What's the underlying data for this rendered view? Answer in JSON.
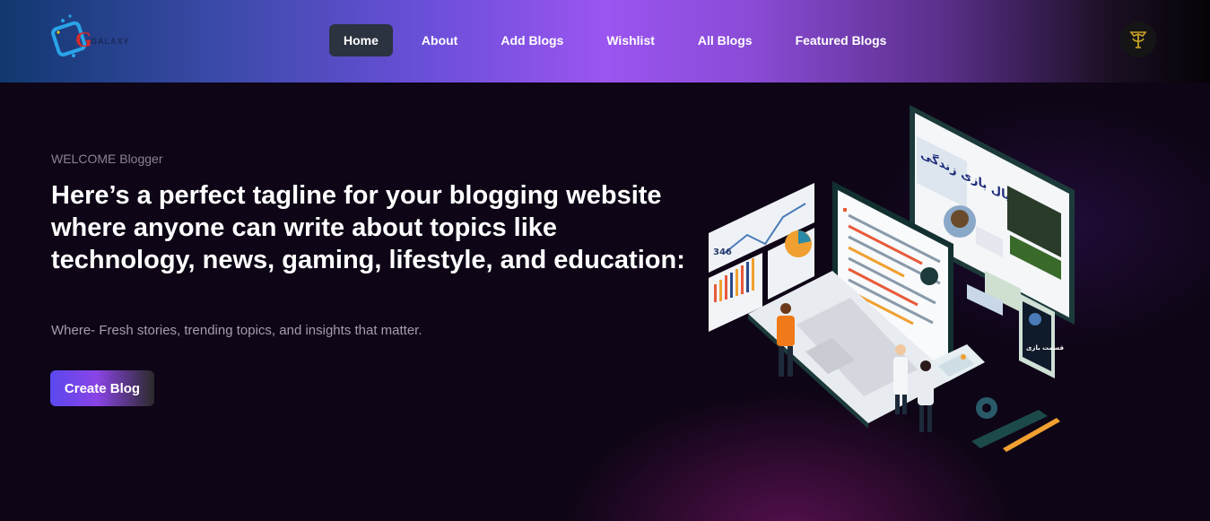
{
  "logo": {
    "text": "GALAXY",
    "icon": "galaxy-logo-icon"
  },
  "nav": {
    "items": [
      {
        "label": "Home",
        "active": true
      },
      {
        "label": "About",
        "active": false
      },
      {
        "label": "Add Blogs",
        "active": false
      },
      {
        "label": "Wishlist",
        "active": false
      },
      {
        "label": "All Blogs",
        "active": false
      },
      {
        "label": "Featured Blogs",
        "active": false
      }
    ]
  },
  "user": {
    "avatar_icon": "user-avatar-emblem"
  },
  "hero": {
    "welcome": "WELCOME Blogger",
    "headline": "Here’s a perfect tagline for your blogging website where anyone can write about topics like technology, news, gaming, lifestyle, and education:",
    "subtext": "Where- Fresh stories, trending topics, and insights that matter.",
    "cta_label": "Create Blog"
  },
  "illustration": {
    "label": "isometric-blogging-illustration",
    "counter_text": "346",
    "monitor_heading": "سریال بازی زندگی",
    "phone_text": "قسمت بازی"
  },
  "colors": {
    "accent_purple": "#9b55f0",
    "nav_active_bg": "#2b3340",
    "hero_bg": "#0e0516"
  }
}
